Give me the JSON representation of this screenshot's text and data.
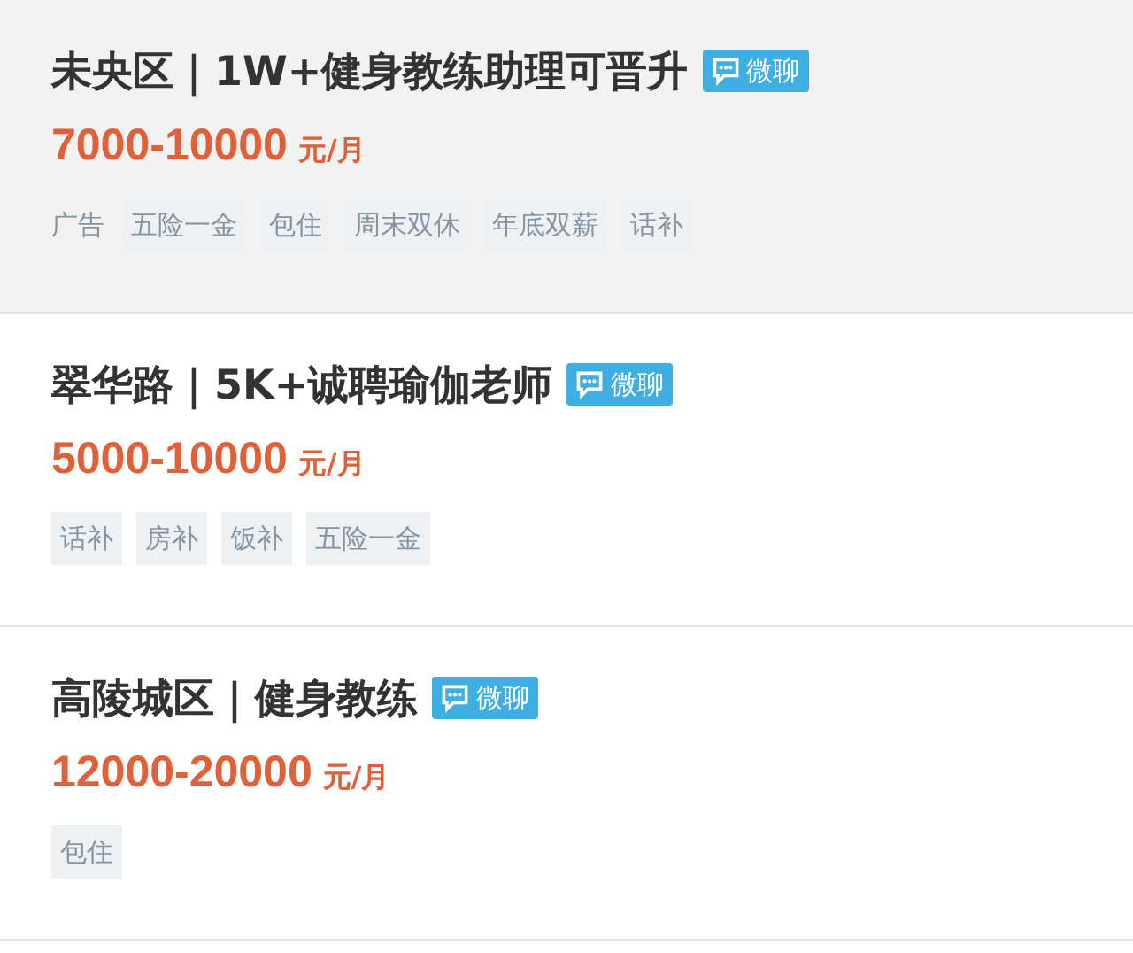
{
  "jobs": [
    {
      "title": "未央区｜1W+健身教练助理可晋升",
      "chat_badge": "微聊",
      "salary": "7000-10000",
      "unit": "元/月",
      "highlighted": true,
      "tags": [
        {
          "kind": "ad",
          "text": "广告"
        },
        {
          "kind": "tag",
          "text": "五险一金"
        },
        {
          "kind": "tag",
          "text": "包住"
        },
        {
          "kind": "tag",
          "text": "周末双休"
        },
        {
          "kind": "tag",
          "text": "年底双薪"
        },
        {
          "kind": "tag",
          "text": "话补"
        }
      ]
    },
    {
      "title": "翠华路｜5K+诚聘瑜伽老师",
      "chat_badge": "微聊",
      "salary": "5000-10000",
      "unit": "元/月",
      "highlighted": false,
      "tags": [
        {
          "kind": "tag",
          "text": "话补"
        },
        {
          "kind": "tag",
          "text": "房补"
        },
        {
          "kind": "tag",
          "text": "饭补"
        },
        {
          "kind": "tag",
          "text": "五险一金"
        }
      ]
    },
    {
      "title": "高陵城区｜健身教练",
      "chat_badge": "微聊",
      "salary": "12000-20000",
      "unit": "元/月",
      "highlighted": false,
      "tags": [
        {
          "kind": "tag",
          "text": "包住"
        }
      ]
    }
  ]
}
